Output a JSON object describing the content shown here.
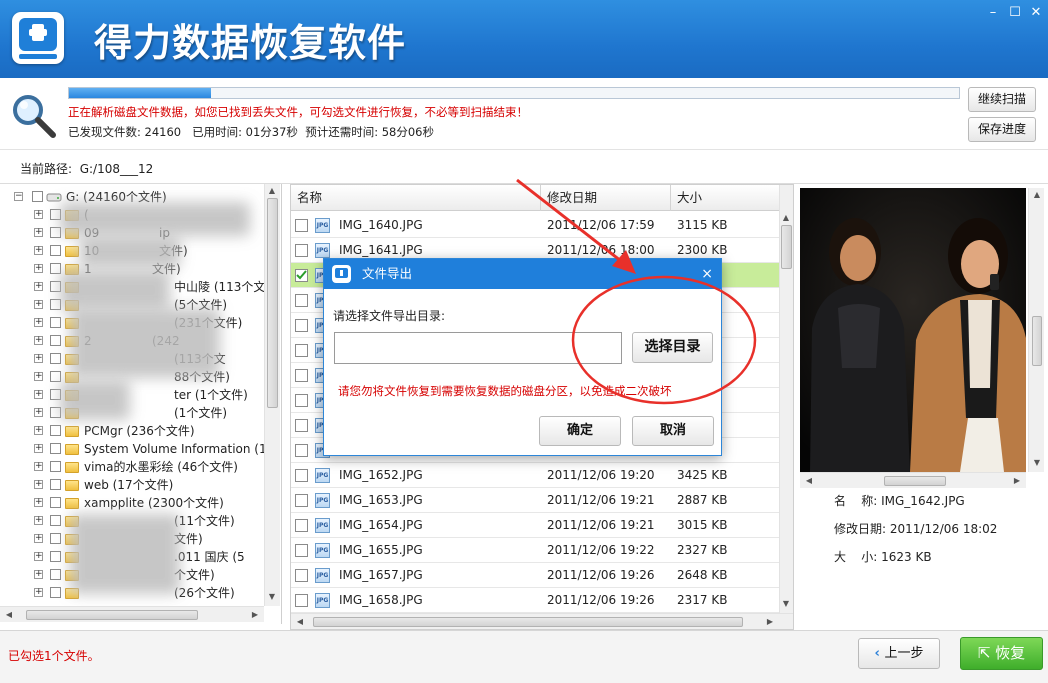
{
  "app": {
    "title": "得力数据恢复软件"
  },
  "window": {
    "minimize": "–",
    "maximize": "☐",
    "close": "✕"
  },
  "scan": {
    "progress_fraction": 0.16,
    "message": "正在解析磁盘文件数据，如您已找到丢失文件，可勾选文件进行恢复，不必等到扫描结束！",
    "found_label": "已发现文件数: 24160",
    "elapsed_label": "已用时间: 01分37秒",
    "remaining_label": "预计还需时间: 58分06秒",
    "continue_button": "继续扫描",
    "save_button": "保存进度"
  },
  "path": {
    "label": "当前路径:",
    "value": "G:/108___12"
  },
  "tree": {
    "root": "G:  (24160个文件)",
    "items": [
      {
        "label": "(",
        "blurred": true
      },
      {
        "label": "09",
        "tail": "ip",
        "blurred": true
      },
      {
        "label": "10",
        "tail": "文件)",
        "blurred": true
      },
      {
        "label": "1",
        "tail": "文件)",
        "blurred": true
      },
      {
        "label": "",
        "tail": "中山陵  (113个文件",
        "blurred": true
      },
      {
        "label": "",
        "tail": "(5个文件)",
        "blurred": true
      },
      {
        "label": "",
        "tail": "(231个文件)",
        "blurred": true
      },
      {
        "label": "2",
        "tail": "(242",
        "blurred": true
      },
      {
        "label": "",
        "tail": "(113个文",
        "blurred": true
      },
      {
        "label": "",
        "tail": "88个文件)",
        "blurred": true
      },
      {
        "label": "",
        "tail": "ter  (1个文件)",
        "blurred": true
      },
      {
        "label": "",
        "tail": "(1个文件)",
        "blurred": true
      },
      {
        "label": "PCMgr  (236个文件)",
        "blurred": false
      },
      {
        "label": "System Volume Information  (1",
        "blurred": false
      },
      {
        "label": "vima的水墨彩绘  (46个文件)",
        "blurred": false
      },
      {
        "label": "web  (17个文件)",
        "blurred": false
      },
      {
        "label": "xampplite  (2300个文件)",
        "blurred": false
      },
      {
        "label": "",
        "tail": "(11个文件)",
        "blurred": true
      },
      {
        "label": "",
        "tail": "文件)",
        "blurred": true
      },
      {
        "label": "",
        "tail": ".011 国庆  (5",
        "blurred": true
      },
      {
        "label": "",
        "tail": "个文件)",
        "blurred": true
      },
      {
        "label": "",
        "tail": "(26个文件)",
        "blurred": true
      }
    ]
  },
  "list": {
    "columns": [
      "名称",
      "修改日期",
      "大小"
    ],
    "icon_text": "JPG",
    "rows": [
      {
        "name": "IMG_1640.JPG",
        "date": "2011/12/06 17:59",
        "size": "3115 KB",
        "checked": false,
        "selected": false
      },
      {
        "name": "IMG_1641.JPG",
        "date": "2011/12/06 18:00",
        "size": "2300 KB",
        "checked": false,
        "selected": false
      },
      {
        "name": "",
        "date": "",
        "size": "",
        "checked": true,
        "selected": true
      },
      {
        "name": "",
        "date": "",
        "size": "",
        "checked": false,
        "selected": false
      },
      {
        "name": "",
        "date": "",
        "size": "",
        "checked": false,
        "selected": false
      },
      {
        "name": "",
        "date": "",
        "size": "",
        "checked": false,
        "selected": false
      },
      {
        "name": "",
        "date": "",
        "size": "",
        "checked": false,
        "selected": false
      },
      {
        "name": "",
        "date": "",
        "size": "",
        "checked": false,
        "selected": false
      },
      {
        "name": "",
        "date": "",
        "size": "",
        "checked": false,
        "selected": false
      },
      {
        "name": "",
        "date": "",
        "size": "",
        "checked": false,
        "selected": false
      },
      {
        "name": "IMG_1652.JPG",
        "date": "2011/12/06 19:20",
        "size": "3425 KB",
        "checked": false,
        "selected": false
      },
      {
        "name": "IMG_1653.JPG",
        "date": "2011/12/06 19:21",
        "size": "2887 KB",
        "checked": false,
        "selected": false
      },
      {
        "name": "IMG_1654.JPG",
        "date": "2011/12/06 19:21",
        "size": "3015 KB",
        "checked": false,
        "selected": false
      },
      {
        "name": "IMG_1655.JPG",
        "date": "2011/12/06 19:22",
        "size": "2327 KB",
        "checked": false,
        "selected": false
      },
      {
        "name": "IMG_1657.JPG",
        "date": "2011/12/06 19:26",
        "size": "2648 KB",
        "checked": false,
        "selected": false
      },
      {
        "name": "IMG_1658.JPG",
        "date": "2011/12/06 19:26",
        "size": "2317 KB",
        "checked": false,
        "selected": false
      }
    ]
  },
  "preview": {
    "name_label": "名    称: IMG_1642.JPG",
    "date_label": "修改日期: 2011/12/06 18:02",
    "size_label": "大    小: 1623 KB"
  },
  "footer": {
    "checked_message": "已勾选1个文件。",
    "prev_button": "上一步",
    "recover_button": "恢复"
  },
  "dialog": {
    "title": "文件导出",
    "close": "×",
    "prompt": "请选择文件导出目录:",
    "input_value": "",
    "browse_button": "选择目录",
    "warning": "请您勿将文件恢复到需要恢复数据的磁盘分区，以免造成二次破坏",
    "ok_button": "确定",
    "cancel_button": "取消"
  },
  "colors": {
    "header_blue": "#1f76cf",
    "accent_red": "#d60000",
    "annotation_red": "#e8302a",
    "selected_green": "#c8ec9a",
    "recover_green": "#4cbb34"
  }
}
